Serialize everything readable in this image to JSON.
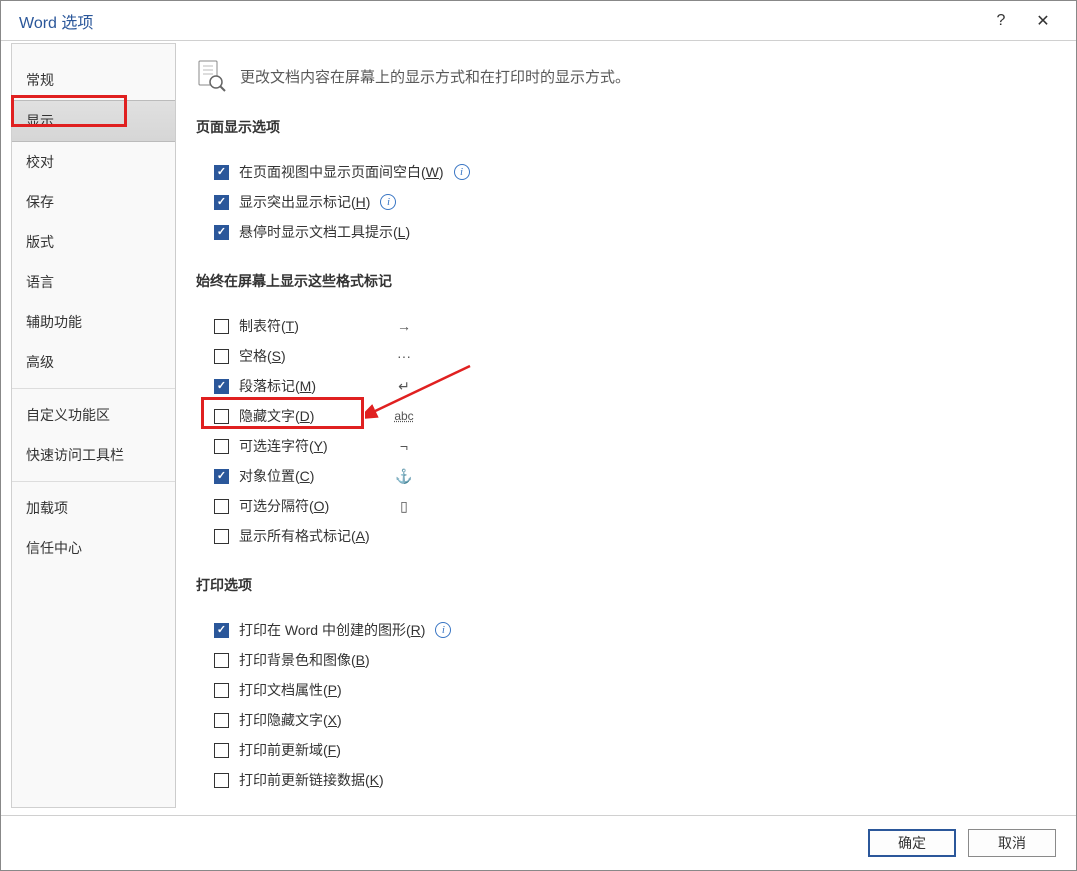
{
  "title": "Word 选项",
  "sidebar": {
    "items": [
      {
        "label": "常规"
      },
      {
        "label": "显示",
        "selected": true,
        "highlighted": true
      },
      {
        "label": "校对"
      },
      {
        "label": "保存"
      },
      {
        "label": "版式"
      },
      {
        "label": "语言"
      },
      {
        "label": "辅助功能"
      },
      {
        "label": "高级"
      },
      {
        "label": "自定义功能区"
      },
      {
        "label": "快速访问工具栏"
      },
      {
        "label": "加载项"
      },
      {
        "label": "信任中心"
      }
    ]
  },
  "intro": "更改文档内容在屏幕上的显示方式和在打印时的显示方式。",
  "sections": {
    "page_display": {
      "title": "页面显示选项",
      "opts": [
        {
          "label": "在页面视图中显示页面间空白(",
          "hot": "W",
          "tail": ")",
          "checked": true,
          "info": true
        },
        {
          "label": "显示突出显示标记(",
          "hot": "H",
          "tail": ")",
          "checked": true,
          "info": true
        },
        {
          "label": "悬停时显示文档工具提示(",
          "hot": "L",
          "tail": ")",
          "checked": true
        }
      ]
    },
    "formatting_marks": {
      "title": "始终在屏幕上显示这些格式标记",
      "opts": [
        {
          "label": "制表符(",
          "hot": "T",
          "tail": ")",
          "checked": false,
          "sym": "→"
        },
        {
          "label": "空格(",
          "hot": "S",
          "tail": ")",
          "checked": false,
          "sym": "···"
        },
        {
          "label": "段落标记(",
          "hot": "M",
          "tail": ")",
          "checked": true,
          "sym": "↵"
        },
        {
          "label": "隐藏文字(",
          "hot": "D",
          "tail": ")",
          "checked": false,
          "sym": "abc",
          "symClass": "abc",
          "boxed": true
        },
        {
          "label": "可选连字符(",
          "hot": "Y",
          "tail": ")",
          "checked": false,
          "sym": "¬"
        },
        {
          "label": "对象位置(",
          "hot": "C",
          "tail": ")",
          "checked": true,
          "sym": "⚓"
        },
        {
          "label": "可选分隔符(",
          "hot": "O",
          "tail": ")",
          "checked": false,
          "sym": "▯"
        },
        {
          "label": "显示所有格式标记(",
          "hot": "A",
          "tail": ")",
          "checked": false
        }
      ]
    },
    "print": {
      "title": "打印选项",
      "opts": [
        {
          "label": "打印在 Word 中创建的图形(",
          "hot": "R",
          "tail": ")",
          "checked": true,
          "info": true
        },
        {
          "label": "打印背景色和图像(",
          "hot": "B",
          "tail": ")",
          "checked": false
        },
        {
          "label": "打印文档属性(",
          "hot": "P",
          "tail": ")",
          "checked": false
        },
        {
          "label": "打印隐藏文字(",
          "hot": "X",
          "tail": ")",
          "checked": false
        },
        {
          "label": "打印前更新域(",
          "hot": "F",
          "tail": ")",
          "checked": false
        },
        {
          "label": "打印前更新链接数据(",
          "hot": "K",
          "tail": ")",
          "checked": false
        }
      ]
    }
  },
  "buttons": {
    "ok": "确定",
    "cancel": "取消"
  },
  "icons": {
    "help": "?",
    "close": "✕"
  }
}
